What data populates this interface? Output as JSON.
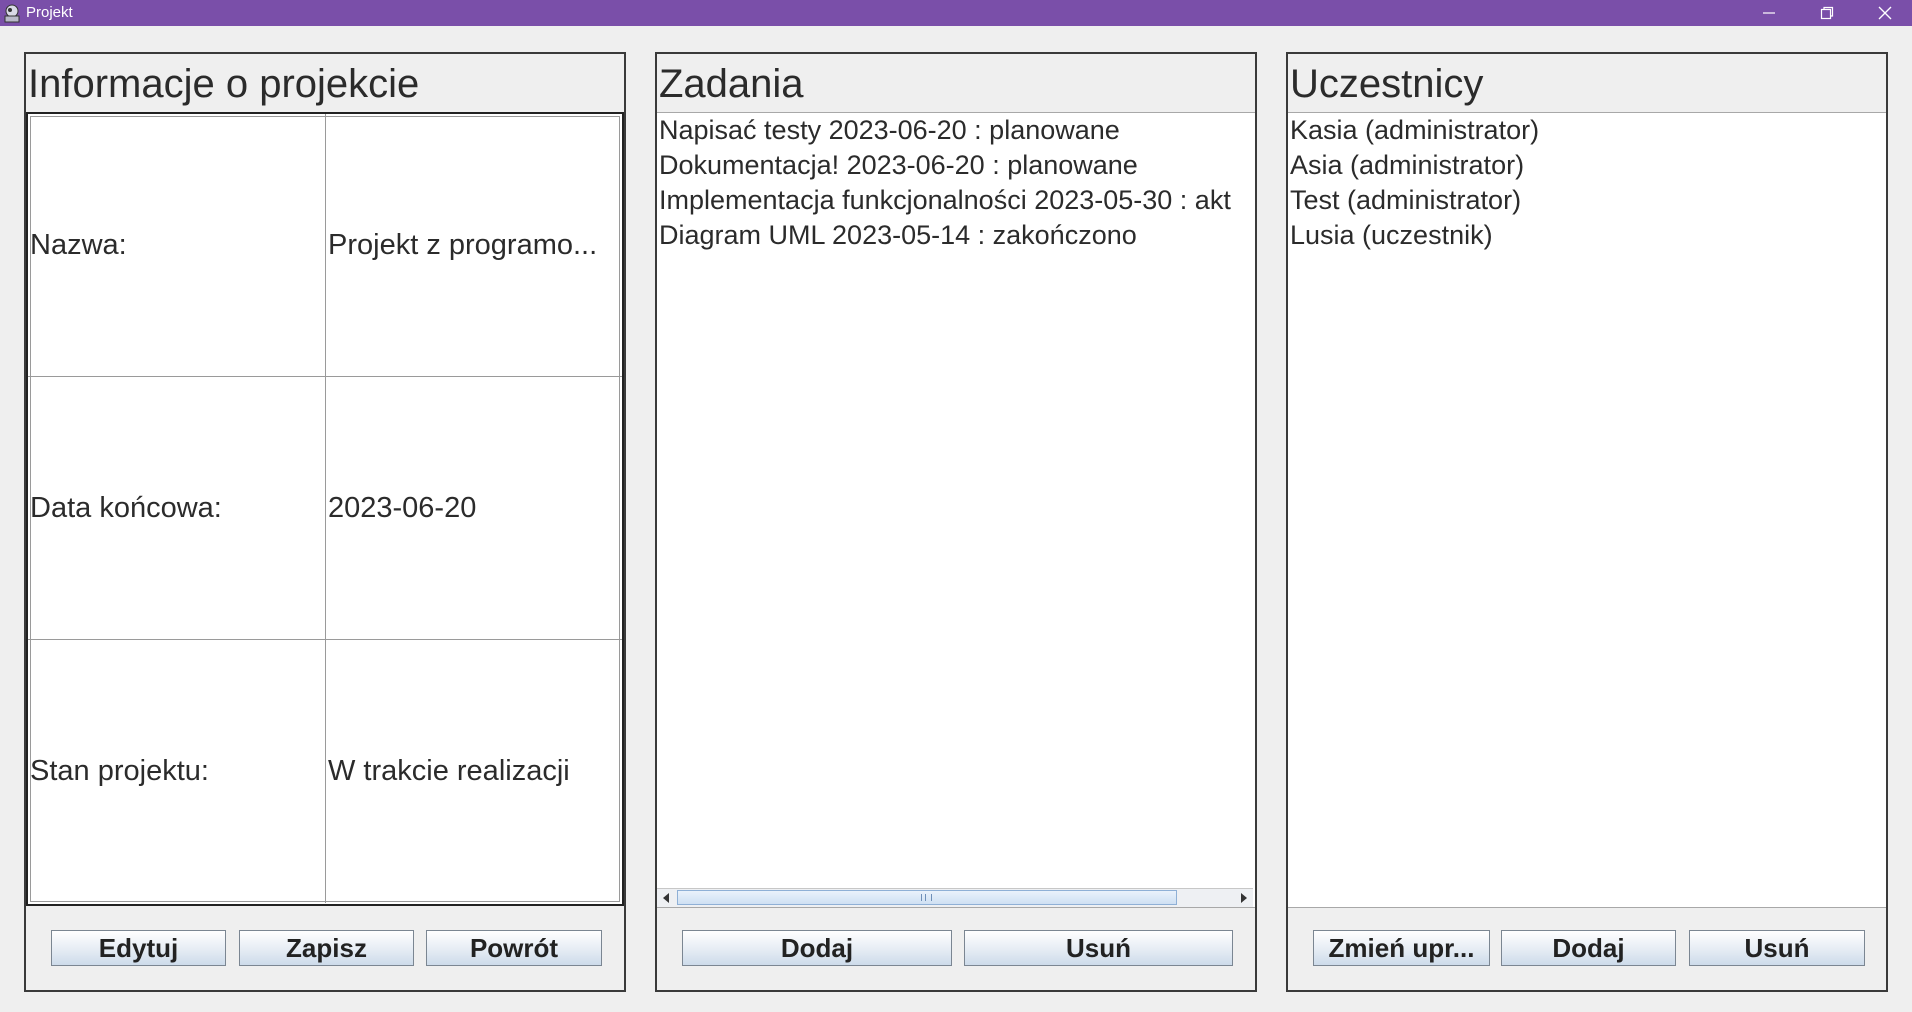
{
  "window": {
    "title": "Projekt"
  },
  "info_panel": {
    "title": "Informacje o projekcie",
    "rows": [
      {
        "label": "Nazwa:",
        "value": "Projekt z programo..."
      },
      {
        "label": "Data końcowa:",
        "value": "2023-06-20"
      },
      {
        "label": "Stan projektu:",
        "value": "W trakcie realizacji"
      }
    ],
    "buttons": {
      "edit": "Edytuj",
      "save": "Zapisz",
      "back": "Powrót"
    }
  },
  "tasks_panel": {
    "title": "Zadania",
    "items": [
      "Napisać testy 2023-06-20 : planowane",
      "Dokumentacja! 2023-06-20 : planowane",
      "Implementacja funkcjonalności 2023-05-30 : akt",
      "Diagram UML 2023-05-14 : zakończono"
    ],
    "buttons": {
      "add": "Dodaj",
      "remove": "Usuń"
    }
  },
  "participants_panel": {
    "title": "Uczestnicy",
    "items": [
      "Kasia (administrator)",
      "Asia (administrator)",
      "Test (administrator)",
      "Lusia (uczestnik)"
    ],
    "buttons": {
      "change_role": "Zmień upr...",
      "add": "Dodaj",
      "remove": "Usuń"
    }
  },
  "colors": {
    "titlebar": "#7a4fa9",
    "background": "#efefef",
    "button_gradient_bottom": "#cddbea"
  }
}
